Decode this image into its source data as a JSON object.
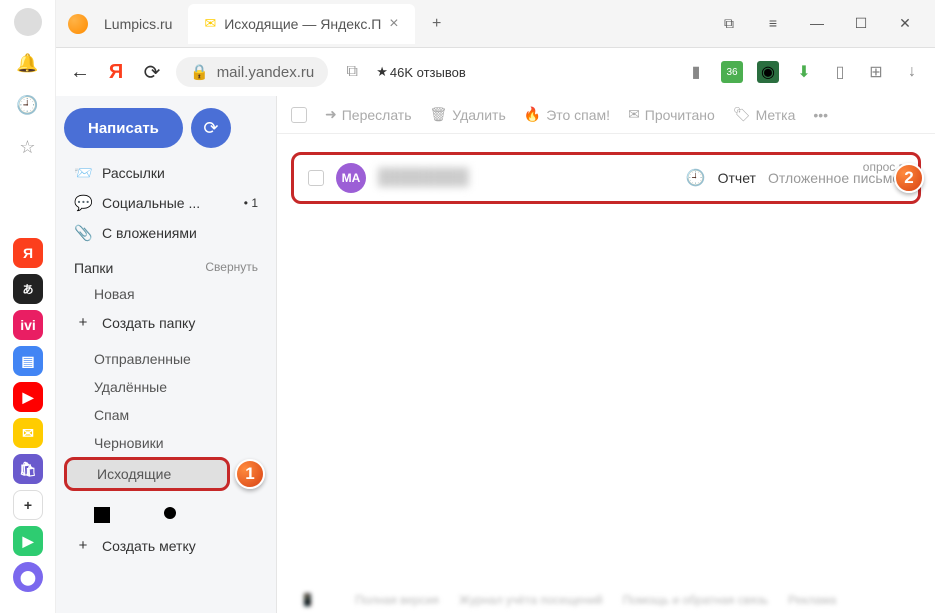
{
  "browser": {
    "tabs": [
      {
        "title": "Lumpics.ru",
        "active": false
      },
      {
        "title": "Исходящие — Яндекс.П",
        "active": true
      }
    ],
    "url": "mail.yandex.ru",
    "reviews": "46K отзывов"
  },
  "sidebar": {
    "compose": "Написать",
    "categories": [
      {
        "icon": "📨",
        "label": "Рассылки"
      },
      {
        "icon": "💬",
        "label": "Социальные ...",
        "badge": "• 1"
      },
      {
        "icon": "📎",
        "label": "С вложениями"
      }
    ],
    "folders_header": "Папки",
    "collapse": "Свернуть",
    "new_folder": "Новая",
    "create_folder": "Создать папку",
    "folders": [
      "Отправленные",
      "Удалённые",
      "Спам",
      "Черновики",
      "Исходящие"
    ],
    "create_label": "Создать метку"
  },
  "toolbar": {
    "forward": "Переслать",
    "delete": "Удалить",
    "spam": "Это спам!",
    "read": "Прочитано",
    "label": "Метка"
  },
  "message": {
    "avatar": "МА",
    "subject": "Отчет",
    "snippet": "Отложенное письмо!"
  },
  "survey": "опрос в...",
  "callouts": {
    "one": "1",
    "two": "2"
  }
}
